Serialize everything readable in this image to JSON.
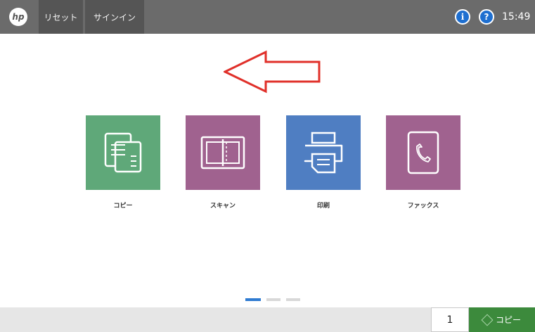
{
  "topbar": {
    "logo_text": "hp",
    "reset_label": "リセット",
    "signin_label": "サインイン",
    "info_icon": "i",
    "help_icon": "?",
    "time": "15:49",
    "bar_color": "#6b6b6b"
  },
  "tiles": [
    {
      "label": "コピー",
      "color": "#5fa879",
      "icon": "copy-icon"
    },
    {
      "label": "スキャン",
      "color": "#a0628f",
      "icon": "scan-icon"
    },
    {
      "label": "印刷",
      "color": "#4f7ec2",
      "icon": "print-icon"
    },
    {
      "label": "ファックス",
      "color": "#a0628f",
      "icon": "fax-icon"
    }
  ],
  "annotation": {
    "arrow_color": "#e0302a"
  },
  "pager": {
    "pages": 3,
    "active": 1
  },
  "bottombar": {
    "quantity": "1",
    "start_label": "コピー"
  }
}
